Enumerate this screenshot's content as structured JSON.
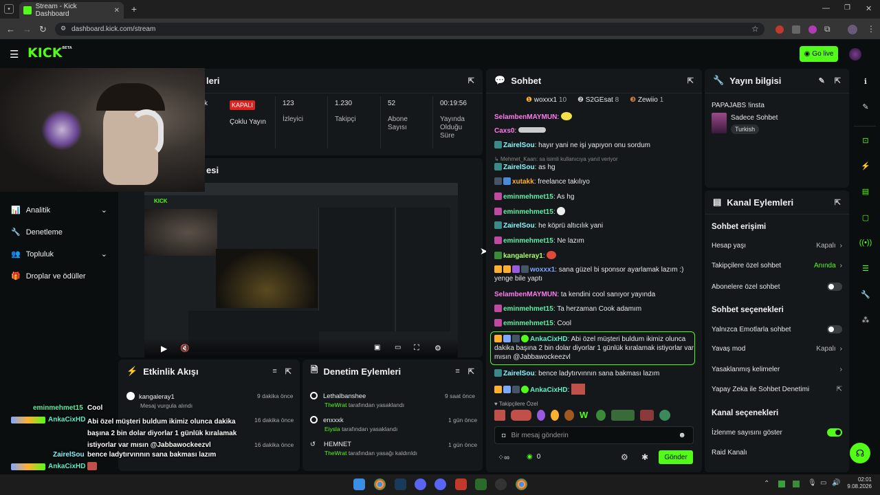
{
  "browser": {
    "tab_title": "Stream - Kick Dashboard",
    "url": "dashboard.kick.com/stream"
  },
  "header": {
    "logo": "KICK",
    "logo_badge": "BETA",
    "go_live": "Go live"
  },
  "stats_panel": {
    "title_fragment": "leri",
    "status_badge": "KAPALI",
    "stats": [
      {
        "value": "",
        "label": "Çoklu Yayın"
      },
      {
        "value": "123",
        "label": "İzleyici"
      },
      {
        "value": "1.230",
        "label": "Takipçi"
      },
      {
        "value": "52",
        "label": "Abone Sayısı"
      },
      {
        "value": "00:19:56",
        "label": "Yayında Olduğu Süre"
      }
    ],
    "left_fragment": "k"
  },
  "preview_panel": {
    "title_fragment": "esi"
  },
  "sidebar": {
    "items": [
      {
        "label": "Analitik",
        "icon": "chart-icon",
        "expandable": true
      },
      {
        "label": "Denetleme",
        "icon": "wrench-icon",
        "expandable": false
      },
      {
        "label": "Topluluk",
        "icon": "people-icon",
        "expandable": true
      },
      {
        "label": "Droplar ve ödüller",
        "icon": "gift-icon",
        "expandable": false
      }
    ]
  },
  "activity_feed": {
    "title": "Etkinlik Akışı",
    "items": [
      {
        "user": "kangaleray1",
        "detail": "Mesaj vurgula alındı",
        "time": "9 dakika önce"
      },
      {
        "user": "",
        "detail": "",
        "time": "16 dakika önce"
      },
      {
        "user": "",
        "detail": "",
        "time": "16 dakika önce"
      }
    ]
  },
  "mod_actions": {
    "title": "Denetim Eylemleri",
    "items": [
      {
        "user": "Lethalbanshee",
        "by": "TheWrat",
        "action": "tarafından yasaklandı",
        "time": "9 saat önce"
      },
      {
        "user": "enxxxk",
        "by": "Eiysla",
        "action": "tarafından yasaklandı",
        "time": "1 gün önce"
      },
      {
        "user": "HEMNET",
        "by": "TheWrat",
        "action": "tarafından yasağı kaldırıldı",
        "time": "1 gün önce"
      }
    ]
  },
  "chat": {
    "title": "Sohbet",
    "top_gifters": [
      {
        "name": "woxxx1",
        "count": "10"
      },
      {
        "name": "S2GEsat",
        "count": "8"
      },
      {
        "name": "Zewiio",
        "count": "1"
      }
    ],
    "messages": [
      {
        "user": "SelambenMAYMUN",
        "text": "",
        "color": "#ff7af0"
      },
      {
        "user": "Caxs0",
        "text": "",
        "color": "#ff7af0"
      },
      {
        "user": "ZairelSou",
        "text": "hayır yani ne işi yapıyon onu sordum",
        "color": "#8af7ff"
      },
      {
        "user": "",
        "text": "Mehmet_Kaan: sa isimli kullanıcıya yanıt veriyor",
        "color": "#888"
      },
      {
        "user": "ZairelSou",
        "text": "as hg",
        "color": "#8af7ff"
      },
      {
        "user": "xutakk",
        "text": "freelance takılıyo",
        "color": "#ffb02e"
      },
      {
        "user": "eminmehmet15",
        "text": "As hg",
        "color": "#5ef0a6"
      },
      {
        "user": "eminmehmet15",
        "text": "",
        "color": "#5ef0a6"
      },
      {
        "user": "ZairelSou",
        "text": "he köprü altıcılık yani",
        "color": "#8af7ff"
      },
      {
        "user": "eminmehmet15",
        "text": "Ne lazım",
        "color": "#5ef0a6"
      },
      {
        "user": "kangaleray1",
        "text": "",
        "color": "#a8ff6b"
      },
      {
        "user": "woxxx1",
        "text": "sana güzel bi sponsor ayarlamak lazım :) yenge bile yaptı",
        "color": "#7fa8ff"
      },
      {
        "user": "SelambenMAYMUN",
        "text": "ta kendini cool sanıyor yayında",
        "color": "#ff7af0"
      },
      {
        "user": "eminmehmet15",
        "text": "Ta herzaman Cook adamım",
        "color": "#5ef0a6"
      },
      {
        "user": "eminmehmet15",
        "text": "Cool",
        "color": "#5ef0a6"
      },
      {
        "user": "AnkaCixHD",
        "text": "Abi özel müşteri buldum ikimiz olunca dakika başına 2 bin dolar diyorlar 1 günlük kıralamak istiyorlar var mısın @Jabbawockeezvl",
        "color": "#5ef0c8"
      },
      {
        "user": "ZairelSou",
        "text": "bence ladytırvınnın sana bakması lazım",
        "color": "#8af7ff"
      },
      {
        "user": "AnkaCixHD",
        "text": "",
        "color": "#5ef0c8"
      }
    ],
    "followers_only_label": "Takipçilere Özel",
    "input_placeholder": "Bir mesaj gönderin",
    "points": "0",
    "send_label": "Gönder"
  },
  "stream_info": {
    "title": "Yayın bilgisi",
    "stream_title": "PAPAJABS !insta",
    "category": "Sadece Sohbet",
    "tag": "Turkish"
  },
  "channel_actions": {
    "title": "Kanal Eylemleri",
    "chat_access": {
      "heading": "Sohbet erişimi",
      "rows": [
        {
          "label": "Hesap yaşı",
          "value": "Kapalı"
        },
        {
          "label": "Takipçilere özel sohbet",
          "value": "Anında"
        },
        {
          "label": "Abonelere özel sohbet",
          "value": ""
        }
      ]
    },
    "chat_options": {
      "heading": "Sohbet seçenekleri",
      "rows": [
        {
          "label": "Yalnızca Emotlarla sohbet",
          "value": ""
        },
        {
          "label": "Yavaş mod",
          "value": "Kapalı"
        },
        {
          "label": "Yasaklanmış kelimeler",
          "value": ""
        },
        {
          "label": "Yapay Zeka ile Sohbet Denetimi",
          "value": ""
        }
      ]
    },
    "channel_options": {
      "heading": "Kanal seçenekleri",
      "rows": [
        {
          "label": "İzlenme sayısını göster",
          "value": ""
        },
        {
          "label": "Raid Kanalı",
          "value": ""
        }
      ]
    }
  },
  "overlay_chat": [
    {
      "user": "eminmehmet15",
      "text": "Cool"
    },
    {
      "user": "AnkaCixHD",
      "text": "Abi özel müşteri buldum ikimiz olunca dakika başına 2 bin dolar diyorlar 1 günlük kıralamak istiyorlar var mısın @Jabbawockeezvl"
    },
    {
      "user": "ZairelSou",
      "text": "bence ladytırvınnın sana bakması lazım"
    },
    {
      "user": "AnkaCixHD",
      "text": ""
    }
  ],
  "taskbar": {
    "time": "02:01",
    "date": "9.08.2026"
  },
  "colors": {
    "accent": "#53fc18",
    "panel": "#14181a",
    "bg": "#0b0e0f"
  }
}
